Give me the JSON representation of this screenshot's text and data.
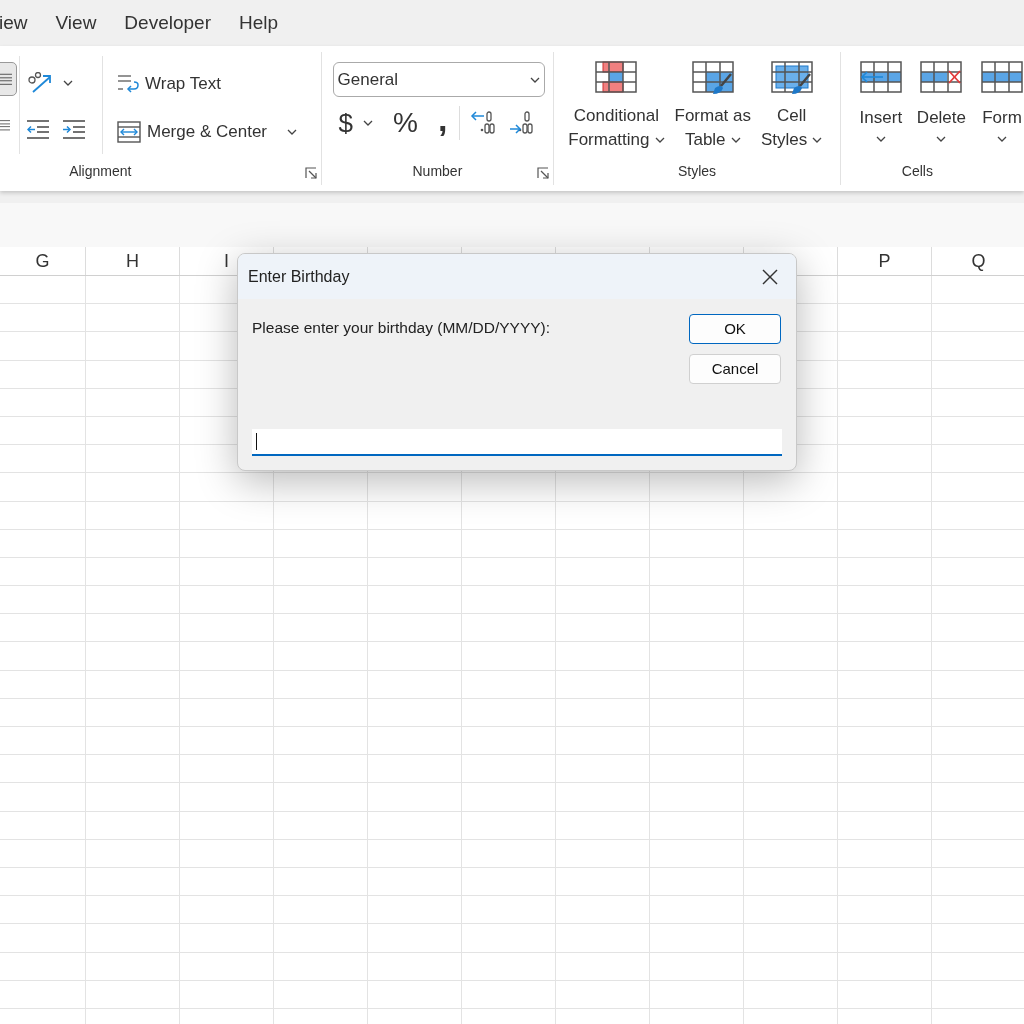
{
  "menu_tabs": [
    {
      "label": "iew"
    },
    {
      "label": "View"
    },
    {
      "label": "Developer"
    },
    {
      "label": "Help"
    }
  ],
  "ribbon": {
    "alignment": {
      "label": "Alignment",
      "align_selected": true,
      "wrap_text": "Wrap Text",
      "merge_center": "Merge & Center"
    },
    "number": {
      "label": "Number",
      "format": "General",
      "symbols": [
        {
          "kind": "currency",
          "text": "$"
        },
        {
          "kind": "percent",
          "text": "%"
        },
        {
          "kind": "comma",
          "text": ","
        }
      ]
    },
    "styles": {
      "label": "Styles",
      "buttons": [
        {
          "kind": "conditional",
          "lines": [
            "Conditional",
            "Formatting"
          ]
        },
        {
          "kind": "table",
          "lines": [
            "Format as",
            "Table"
          ]
        },
        {
          "kind": "cell",
          "lines": [
            "Cell",
            "Styles"
          ]
        }
      ]
    },
    "cells": {
      "label": "Cells",
      "buttons": [
        {
          "kind": "insert",
          "label": "Insert"
        },
        {
          "kind": "delete",
          "label": "Delete"
        },
        {
          "kind": "format",
          "label": "Form"
        }
      ]
    }
  },
  "sheet": {
    "columns_left": [
      "G",
      "H",
      "I"
    ],
    "columns_right": [
      "P",
      "Q"
    ]
  },
  "dialog": {
    "title": "Enter Birthday",
    "prompt": "Please enter your birthday (MM/DD/YYYY):",
    "buttons": [
      {
        "label": "OK",
        "default": true
      },
      {
        "label": "Cancel",
        "default": false
      }
    ],
    "input": {
      "focused": true
    }
  }
}
